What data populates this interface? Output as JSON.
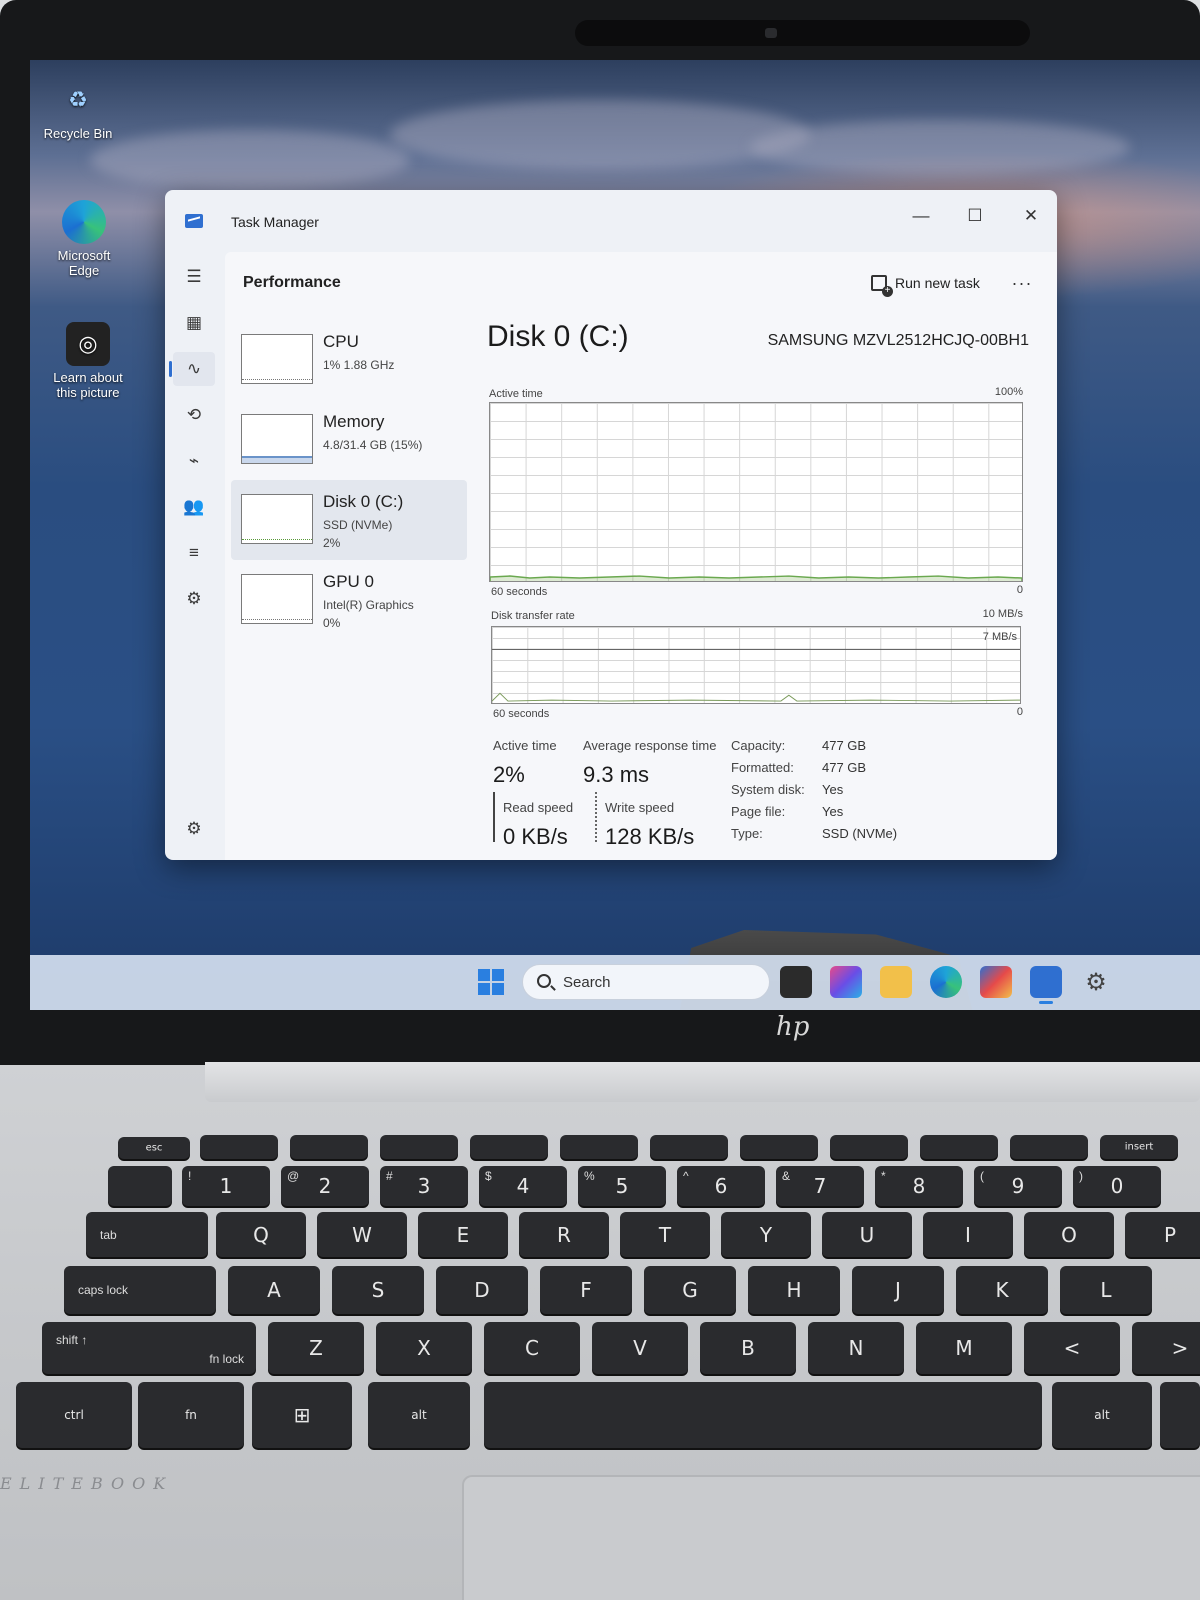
{
  "desktop": {
    "icons": [
      {
        "label": "Recycle Bin",
        "icon": "recycle-bin-icon"
      },
      {
        "label": "Microsoft Edge",
        "icon": "edge-icon"
      },
      {
        "label": "Learn about this picture",
        "icon": "camera-icon"
      }
    ]
  },
  "window": {
    "title": "Task Manager",
    "minimize": "—",
    "maximize": "☐",
    "close": "✕"
  },
  "nav": {
    "items": [
      {
        "name": "hamburger-icon",
        "glyph": "☰"
      },
      {
        "name": "processes-icon",
        "glyph": "▦"
      },
      {
        "name": "performance-icon",
        "glyph": "∿",
        "active": true
      },
      {
        "name": "app-history-icon",
        "glyph": "⟲"
      },
      {
        "name": "startup-apps-icon",
        "glyph": "⌁"
      },
      {
        "name": "users-icon",
        "glyph": "👥"
      },
      {
        "name": "details-icon",
        "glyph": "≡"
      },
      {
        "name": "services-icon",
        "glyph": "⚙"
      }
    ],
    "settings": "⚙"
  },
  "header": {
    "page_title": "Performance",
    "run_new_task": "Run new task",
    "more": "···"
  },
  "perf_list": [
    {
      "name": "CPU",
      "sub1": "1% 1.88 GHz",
      "sub2": ""
    },
    {
      "name": "Memory",
      "sub1": "4.8/31.4 GB (15%)",
      "sub2": ""
    },
    {
      "name": "Disk 0 (C:)",
      "sub1": "SSD (NVMe)",
      "sub2": "2%"
    },
    {
      "name": "GPU 0",
      "sub1": "Intel(R) Graphics",
      "sub2": "0%"
    }
  ],
  "detail": {
    "title": "Disk 0 (C:)",
    "model": "SAMSUNG MZVL2512HCJQ-00BH1",
    "graph1": {
      "label": "Active time",
      "max": "100%",
      "time": "60 seconds",
      "min": "0"
    },
    "graph2": {
      "label": "Disk transfer rate",
      "max": "10 MB/s",
      "mark": "7 MB/s",
      "time": "60 seconds",
      "min": "0"
    },
    "stats": {
      "active_time_label": "Active time",
      "active_time_value": "2%",
      "avg_response_label": "Average response time",
      "avg_response_value": "9.3 ms",
      "read_label": "Read speed",
      "read_value": "0 KB/s",
      "write_label": "Write speed",
      "write_value": "128 KB/s"
    },
    "props": [
      {
        "key": "Capacity:",
        "value": "477 GB"
      },
      {
        "key": "Formatted:",
        "value": "477 GB"
      },
      {
        "key": "System disk:",
        "value": "Yes"
      },
      {
        "key": "Page file:",
        "value": "Yes"
      },
      {
        "key": "Type:",
        "value": "SSD (NVMe)"
      }
    ]
  },
  "taskbar": {
    "search_label": "Search"
  },
  "laptop": {
    "logo": "hp",
    "brand": "ELITEBOOK",
    "keys": {
      "esc": "esc",
      "tab": "tab",
      "caps": "caps lock",
      "shift": "shift ↑",
      "fnlock": "fn lock",
      "ctrl": "ctrl",
      "fn": "fn",
      "alt": "alt",
      "insert": "insert",
      "num": [
        "1",
        "2",
        "3",
        "4",
        "5",
        "6",
        "7",
        "8",
        "9",
        "0"
      ],
      "num_shift": [
        "!",
        "@",
        "#",
        "$",
        "%",
        "^",
        "&",
        "*",
        "(",
        ")"
      ],
      "row_q": [
        "Q",
        "W",
        "E",
        "R",
        "T",
        "Y",
        "U",
        "I",
        "O",
        "P"
      ],
      "row_a": [
        "A",
        "S",
        "D",
        "F",
        "G",
        "H",
        "J",
        "K",
        "L"
      ],
      "row_z": [
        "Z",
        "X",
        "C",
        "V",
        "B",
        "N",
        "M",
        "<",
        ">"
      ]
    }
  }
}
